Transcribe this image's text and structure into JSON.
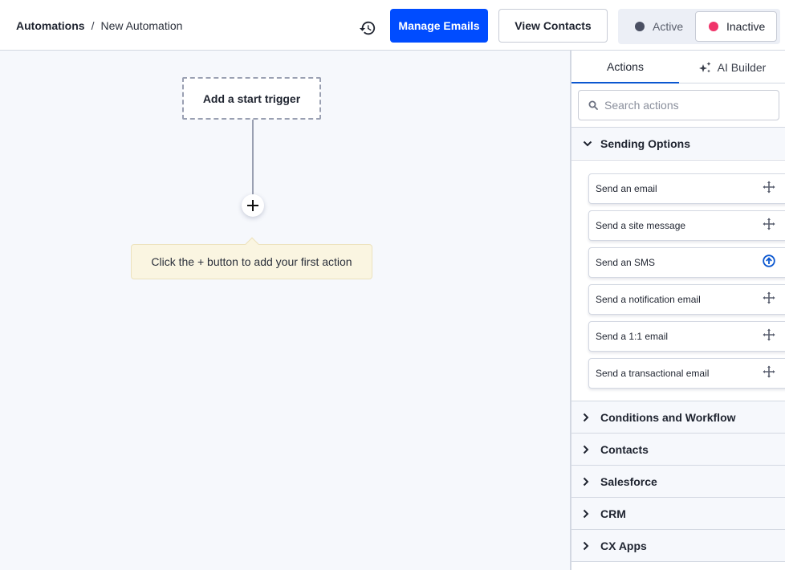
{
  "header": {
    "breadcrumb": {
      "root": "Automations",
      "separator": "/",
      "current": "New Automation"
    },
    "history_icon": "history-icon",
    "manage_emails_label": "Manage Emails",
    "view_contacts_label": "View Contacts",
    "status": {
      "active_label": "Active",
      "inactive_label": "Inactive",
      "selected": "Inactive",
      "active_color": "#4b5063",
      "inactive_color": "#f0346a"
    }
  },
  "canvas": {
    "trigger_label": "Add a start trigger",
    "add_button_icon": "plus-icon",
    "hint_text": "Click the + button to add your first action"
  },
  "panel": {
    "tabs": [
      {
        "label": "Actions",
        "selected": true
      },
      {
        "label": "AI Builder",
        "icon": "sparkle-icon",
        "selected": false
      }
    ],
    "search": {
      "placeholder": "Search actions",
      "value": ""
    },
    "sections": [
      {
        "label": "Sending Options",
        "expanded": true,
        "items": [
          {
            "label": "Send an email",
            "icon": "move-icon"
          },
          {
            "label": "Send a site message",
            "icon": "move-icon"
          },
          {
            "label": "Send an SMS",
            "icon": "upgrade-icon"
          },
          {
            "label": "Send a notification email",
            "icon": "move-icon"
          },
          {
            "label": "Send a 1:1 email",
            "icon": "move-icon"
          },
          {
            "label": "Send a transactional email",
            "icon": "move-icon"
          }
        ]
      },
      {
        "label": "Conditions and Workflow",
        "expanded": false
      },
      {
        "label": "Contacts",
        "expanded": false
      },
      {
        "label": "Salesforce",
        "expanded": false
      },
      {
        "label": "CRM",
        "expanded": false
      },
      {
        "label": "CX Apps",
        "expanded": false
      }
    ]
  },
  "colors": {
    "primary": "#004cff",
    "tab_underline": "#0b57d0",
    "upgrade_icon": "#0b57d0",
    "canvas_bg": "#f6f8fc",
    "hint_bg": "#faf5e1"
  }
}
